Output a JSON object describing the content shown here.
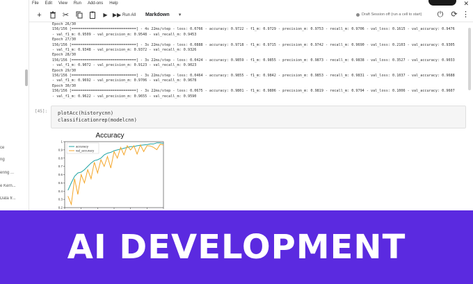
{
  "menu": [
    "File",
    "Edit",
    "View",
    "Run",
    "Add-ons",
    "Help"
  ],
  "toolbar": {
    "run_all_label": "Run All",
    "cell_type": "Markdown",
    "session_status": "Draft Session off (run a cell to start)"
  },
  "sidebar": {
    "items": [
      "ce",
      "ng",
      "ering ...",
      "e Kern...",
      "Data fr..."
    ]
  },
  "log_lines": [
    "Epoch 26/30",
    "156/156 [==============================] - 4s 22ms/step - loss: 0.0766 - accuracy: 0.9722 - f1_m: 0.9729 - precision_m: 0.9753 - recall_m: 0.9706 - val_loss: 0.1615 - val_accuracy: 0.9476",
    "- val_f1_m: 0.9509 - val_precision_m: 0.9548 - val_recall_m: 0.9453",
    "Epoch 27/30",
    "156/156 [==============================] - 3s 22ms/step - loss: 0.0888 - accuracy: 0.9718 - f1_m: 0.9715 - precision_m: 0.9742 - recall_m: 0.9690 - val_loss: 0.2103 - val_accuracy: 0.9305",
    "- val_f1_m: 0.9348 - val_precision_m: 0.9372 - val_recall_m: 0.9326",
    "Epoch 28/30",
    "156/156 [==============================] - 3s 22ms/step - loss: 0.0424 - accuracy: 0.9859 - f1_m: 0.9855 - precision_m: 0.9873 - recall_m: 0.9838 - val_loss: 0.3527 - val_accuracy: 0.9033",
    "- val_f1_m: 0.9072 - val_precision_m: 0.9123 - val_recall_m: 0.9023",
    "Epoch 29/30",
    "156/156 [==============================] - 3s 22ms/step - loss: 0.0464 - accuracy: 0.9855 - f1_m: 0.9842 - precision_m: 0.9853 - recall_m: 0.9831 - val_loss: 0.1037 - val_accuracy: 0.9688",
    "- val_f1_m: 0.9692 - val_precision_m: 0.9706 - val_recall_m: 0.9678",
    "Epoch 30/30",
    "156/156 [==============================] - 3s 22ms/step - loss: 0.0675 - accuracy: 0.9801 - f1_m: 0.9806 - precision_m: 0.9819 - recall_m: 0.9794 - val_loss: 0.1006 - val_accuracy: 0.9607",
    "- val_f1_m: 0.9622 - val_precision_m: 0.9655 - val_recall_m: 0.9590"
  ],
  "cell": {
    "prompt": "[45]:",
    "code_lines": [
      "plotAcc(historycnn)",
      "classificationrep(modelcnn)"
    ]
  },
  "chart_data": {
    "type": "line",
    "title": "Accuracy",
    "xlabel": "",
    "ylabel": "",
    "ylim": [
      0.2,
      1.0
    ],
    "yticks": [
      0.2,
      0.3,
      0.4,
      0.5,
      0.6,
      0.7,
      0.8,
      0.9,
      1.0
    ],
    "xlim": [
      0,
      30
    ],
    "legend_position": "top-left",
    "series": [
      {
        "name": "accuracy",
        "color": "#1fa3a3",
        "x": [
          1,
          2,
          3,
          4,
          5,
          6,
          7,
          8,
          9,
          10,
          11,
          12,
          13,
          14,
          15,
          16,
          17,
          18,
          19,
          20,
          21,
          22,
          23,
          24,
          25,
          26,
          27,
          28,
          29,
          30
        ],
        "values": [
          0.41,
          0.5,
          0.58,
          0.62,
          0.63,
          0.66,
          0.7,
          0.74,
          0.77,
          0.78,
          0.8,
          0.84,
          0.86,
          0.87,
          0.89,
          0.9,
          0.91,
          0.92,
          0.93,
          0.94,
          0.94,
          0.95,
          0.955,
          0.96,
          0.965,
          0.972,
          0.972,
          0.986,
          0.986,
          0.98
        ]
      },
      {
        "name": "val_accuracy",
        "color": "#f4a62a",
        "x": [
          1,
          2,
          3,
          4,
          5,
          6,
          7,
          8,
          9,
          10,
          11,
          12,
          13,
          14,
          15,
          16,
          17,
          18,
          19,
          20,
          21,
          22,
          23,
          24,
          25,
          26,
          27,
          28,
          29,
          30
        ],
        "values": [
          0.34,
          0.24,
          0.55,
          0.36,
          0.6,
          0.5,
          0.66,
          0.55,
          0.75,
          0.62,
          0.78,
          0.7,
          0.82,
          0.68,
          0.88,
          0.8,
          0.93,
          0.84,
          0.95,
          0.9,
          0.95,
          0.85,
          0.96,
          0.88,
          0.95,
          0.948,
          0.93,
          0.903,
          0.969,
          0.961
        ]
      }
    ]
  },
  "banner": {
    "text": "AI DEVELOPMENT"
  }
}
